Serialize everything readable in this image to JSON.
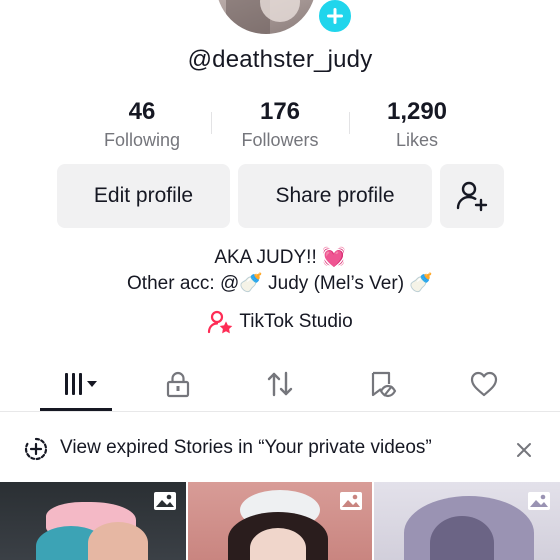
{
  "profile": {
    "username": "@deathster_judy",
    "stats": [
      {
        "value": "46",
        "label": "Following"
      },
      {
        "value": "176",
        "label": "Followers"
      },
      {
        "value": "1,290",
        "label": "Likes"
      }
    ],
    "buttons": {
      "edit": "Edit profile",
      "share": "Share profile"
    },
    "bio": {
      "line1": "AKA JUDY!! 💓",
      "line2": "Other acc: @🍼 Judy (Mel’s Ver) 🍼"
    },
    "studio_link": "TikTok Studio"
  },
  "tabs": [
    "videos-grid",
    "private",
    "reposts",
    "favorites",
    "liked"
  ],
  "notice": {
    "text": "View expired Stories in “Your private videos”"
  },
  "colors": {
    "accent_cyan": "#20d5ec",
    "studio_pink": "#fe2c55",
    "text_primary": "#161823",
    "text_secondary": "#75767c",
    "button_bg": "#f1f1f2"
  }
}
